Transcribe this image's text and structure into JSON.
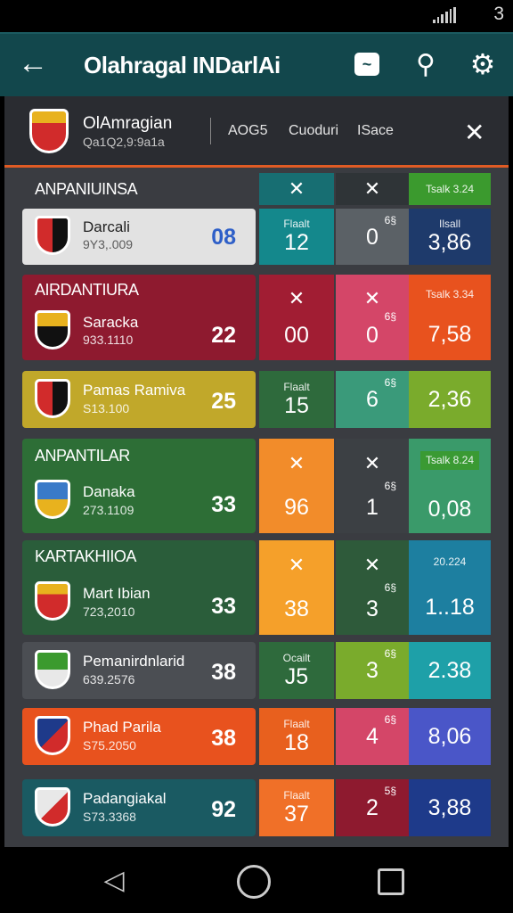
{
  "status_bar": {
    "battery_text": "3"
  },
  "app_bar": {
    "title": "Olahragal INDarlAi",
    "back_icon": "arrow-left-icon",
    "icons": [
      "trend-icon",
      "search-icon",
      "gear-icon"
    ]
  },
  "match": {
    "name": "OlAmragian",
    "sub": "Qa1Q2,9:9a1a",
    "tabs": [
      "AOG5",
      "Cuoduri",
      "ISace"
    ]
  },
  "sections": [
    {
      "title": "ANPANIUINSA",
      "team": {
        "name": "Darcali",
        "value": "9Y3,.009",
        "score": "08"
      },
      "cells": [
        {
          "mark": "✕",
          "label": "",
          "num": ""
        },
        {
          "mark": "✕",
          "label": "",
          "num": ""
        },
        {
          "mark": "",
          "label": "Tsalk 3.24",
          "num": ""
        }
      ]
    }
  ],
  "rows": [
    {
      "header": "ANPANIUINSA",
      "name": "Darcali",
      "value": "9Y3,.009",
      "score": "08",
      "c1": {
        "label": "Flaalt",
        "num": "12"
      },
      "c2": {
        "sup": "6§",
        "num": "0"
      },
      "c3": {
        "label": "Ilsall",
        "num": "3,86"
      },
      "head_marks": [
        "✕",
        "✕",
        "Tsalk 3.24"
      ]
    },
    {
      "header": "AIRDANTIURA",
      "name": "Saracka",
      "value": "933.1110",
      "score": "22",
      "c1": {
        "label": "",
        "num": "00"
      },
      "c2": {
        "sup": "6§",
        "num": "0"
      },
      "c3": {
        "label": "",
        "num": "7,58"
      },
      "head_marks": [
        "✕",
        "✕",
        "Tsalk 3.34"
      ]
    },
    {
      "header": "",
      "name": "Pamas Ramiva",
      "value": "S13.100",
      "score": "25",
      "c1": {
        "label": "Flaalt",
        "num": "15"
      },
      "c2": {
        "sup": "6§",
        "num": "6"
      },
      "c3": {
        "label": "",
        "num": "2,36"
      },
      "head_marks": []
    },
    {
      "header": "ANPANTILAR",
      "name": "Danaka",
      "value": "273.1109",
      "score": "33",
      "c1": {
        "label": "",
        "num": "96"
      },
      "c2": {
        "sup": "6§",
        "num": "1"
      },
      "c3": {
        "label": "",
        "num": "0,08"
      },
      "head_marks": [
        "✕",
        "✕",
        "Tsalk 8.24"
      ]
    },
    {
      "header": "KARTAKHIIOA",
      "name": "Mart Ibian",
      "value": "723,2010",
      "score": "33",
      "c1": {
        "label": "",
        "num": "38"
      },
      "c2": {
        "sup": "6§",
        "num": "3"
      },
      "c3": {
        "label": "",
        "num": "1..18"
      },
      "head_marks": [
        "✕",
        "✕",
        "20.224"
      ]
    },
    {
      "header": "",
      "name": "Pemanirdnlarid",
      "value": "639.2576",
      "score": "38",
      "c1": {
        "label": "Ocailt",
        "num": "J5"
      },
      "c2": {
        "sup": "6§",
        "num": "3"
      },
      "c3": {
        "label": "",
        "num": "2.38"
      },
      "head_marks": []
    },
    {
      "header": "",
      "name": "Phad Parila",
      "value": "S75.2050",
      "score": "38",
      "c1": {
        "label": "Flaalt",
        "num": "18"
      },
      "c2": {
        "sup": "6§",
        "num": "4"
      },
      "c3": {
        "label": "",
        "num": "8,06"
      },
      "head_marks": []
    },
    {
      "header": "",
      "name": "Padangiakal",
      "value": "S73.3368",
      "score": "92",
      "c1": {
        "label": "Flaalt",
        "num": "37"
      },
      "c2": {
        "sup": "5§",
        "num": "2"
      },
      "c3": {
        "label": "",
        "num": "3,88"
      },
      "head_marks": []
    }
  ],
  "colors": {
    "app_bar": "#12474c",
    "accent": "#e05b24"
  }
}
